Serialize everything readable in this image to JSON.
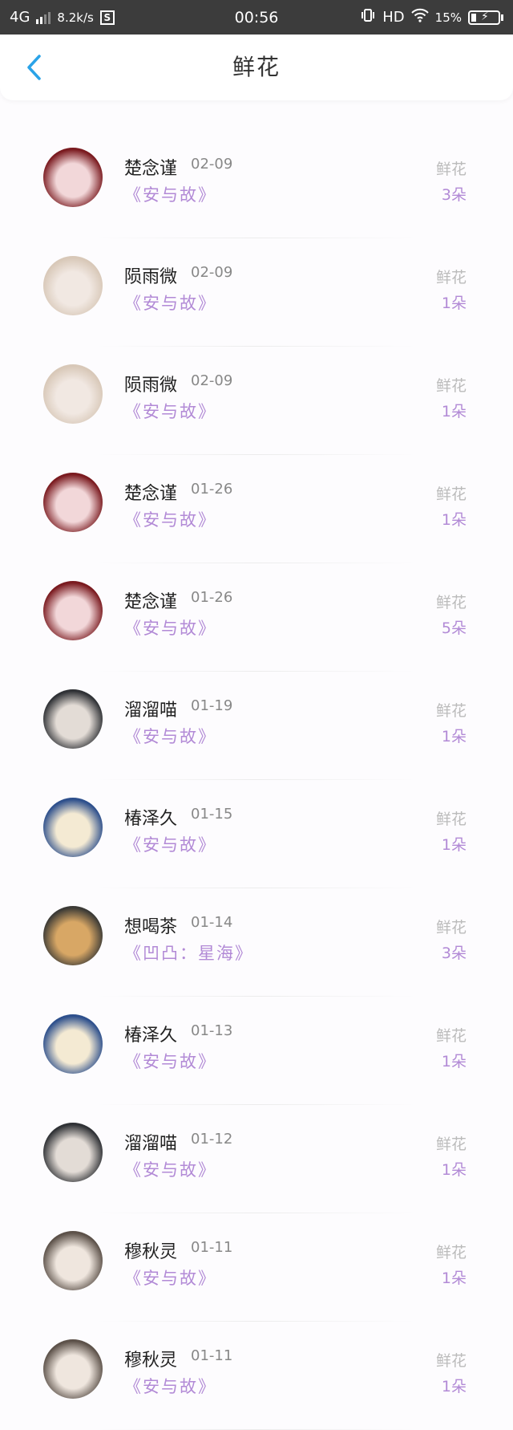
{
  "status_bar": {
    "network": "4G",
    "speed": "8.2k/s",
    "s_label": "S",
    "time": "00:56",
    "hd": "HD",
    "battery": "15%"
  },
  "header": {
    "title": "鲜花"
  },
  "avatar_palettes": {
    "red": [
      "#7a1a1f",
      "#f2d7d9"
    ],
    "beige": [
      "#d8c8b8",
      "#f1e8e2"
    ],
    "dark": [
      "#2f3135",
      "#e3dcd6"
    ],
    "blue": [
      "#2d4f8c",
      "#f4ead3"
    ],
    "dog": [
      "#3b3a36",
      "#d8a765"
    ],
    "sepia": [
      "#5c5149",
      "#efe6de"
    ]
  },
  "items": [
    {
      "name": "楚念谨",
      "date": "02-09",
      "gift": "《安与故》",
      "type": "鲜花",
      "count": "3朵",
      "avatar": "red"
    },
    {
      "name": "陨雨微",
      "date": "02-09",
      "gift": "《安与故》",
      "type": "鲜花",
      "count": "1朵",
      "avatar": "beige"
    },
    {
      "name": "陨雨微",
      "date": "02-09",
      "gift": "《安与故》",
      "type": "鲜花",
      "count": "1朵",
      "avatar": "beige"
    },
    {
      "name": "楚念谨",
      "date": "01-26",
      "gift": "《安与故》",
      "type": "鲜花",
      "count": "1朵",
      "avatar": "red"
    },
    {
      "name": "楚念谨",
      "date": "01-26",
      "gift": "《安与故》",
      "type": "鲜花",
      "count": "5朵",
      "avatar": "red"
    },
    {
      "name": "溜溜喵",
      "date": "01-19",
      "gift": "《安与故》",
      "type": "鲜花",
      "count": "1朵",
      "avatar": "dark"
    },
    {
      "name": "椿泽久",
      "date": "01-15",
      "gift": "《安与故》",
      "type": "鲜花",
      "count": "1朵",
      "avatar": "blue"
    },
    {
      "name": "想喝茶",
      "date": "01-14",
      "gift": "《凹凸：星海》",
      "type": "鲜花",
      "count": "3朵",
      "avatar": "dog"
    },
    {
      "name": "椿泽久",
      "date": "01-13",
      "gift": "《安与故》",
      "type": "鲜花",
      "count": "1朵",
      "avatar": "blue"
    },
    {
      "name": "溜溜喵",
      "date": "01-12",
      "gift": "《安与故》",
      "type": "鲜花",
      "count": "1朵",
      "avatar": "dark"
    },
    {
      "name": "穆秋灵",
      "date": "01-11",
      "gift": "《安与故》",
      "type": "鲜花",
      "count": "1朵",
      "avatar": "sepia"
    },
    {
      "name": "穆秋灵",
      "date": "01-11",
      "gift": "《安与故》",
      "type": "鲜花",
      "count": "1朵",
      "avatar": "sepia"
    }
  ]
}
